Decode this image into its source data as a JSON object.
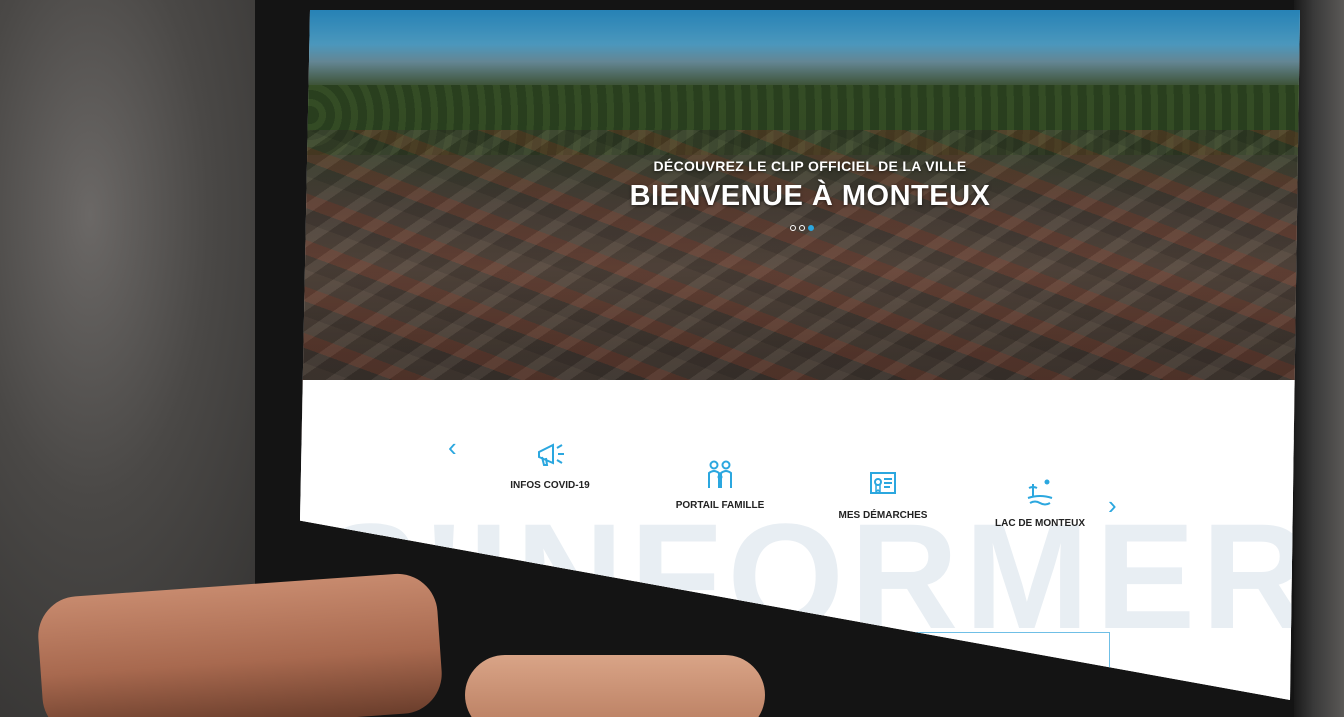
{
  "hero": {
    "subtitle": "DÉCOUVREZ LE CLIP OFFICIEL DE LA VILLE",
    "title": "BIENVENUE À MONTEUX",
    "slides": 3,
    "active_slide": 3
  },
  "quick_links": {
    "items": [
      {
        "label": "INFOS COVID-19",
        "icon": "megaphone-icon"
      },
      {
        "label": "PORTAIL FAMILLE",
        "icon": "family-icon"
      },
      {
        "label": "MES DÉMARCHES",
        "icon": "certificate-icon"
      },
      {
        "label": "LAC DE MONTEUX",
        "icon": "lake-icon"
      }
    ],
    "prev_icon": "chevron-left-icon",
    "next_icon": "chevron-right-icon"
  },
  "section": {
    "watermark": "S'INFORMER"
  },
  "colors": {
    "accent": "#2ba7df",
    "text": "#222222",
    "watermark": "#e8eef3"
  }
}
